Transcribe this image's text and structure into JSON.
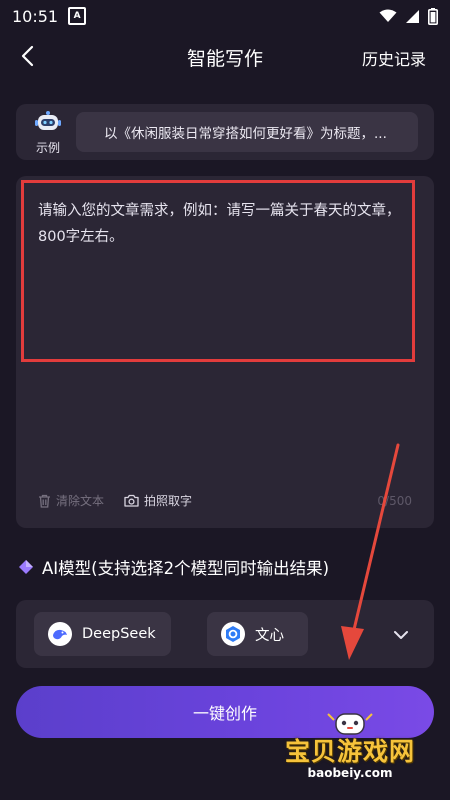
{
  "status_bar": {
    "time": "10:51",
    "notification_badge": "A"
  },
  "nav": {
    "title": "智能写作",
    "history_label": "历史记录"
  },
  "example": {
    "badge_label": "示例",
    "text": "以《休闲服装日常穿搭如何更好看》为标题，..."
  },
  "editor": {
    "placeholder": "请输入您的文章需求，例如：请写一篇关于春天的文章，800字左右。",
    "value": "",
    "clear_label": "清除文本",
    "photo_label": "拍照取字",
    "char_count": "0/500"
  },
  "model_section": {
    "heading": "AI模型(支持选择2个模型同时输出结果)",
    "models": [
      {
        "label": "DeepSeek",
        "icon": "deepseek-logo-icon"
      },
      {
        "label": "文心",
        "icon": "wenxin-logo-icon"
      }
    ]
  },
  "create_button": {
    "label": "一键创作"
  },
  "watermark": {
    "title": "宝贝游戏网",
    "url": "baobeiy.com"
  },
  "colors": {
    "background": "#1b1725",
    "card": "#2b2635",
    "chip": "#3a3444",
    "accent": "#6a43dc",
    "highlight": "#e23c3c"
  }
}
